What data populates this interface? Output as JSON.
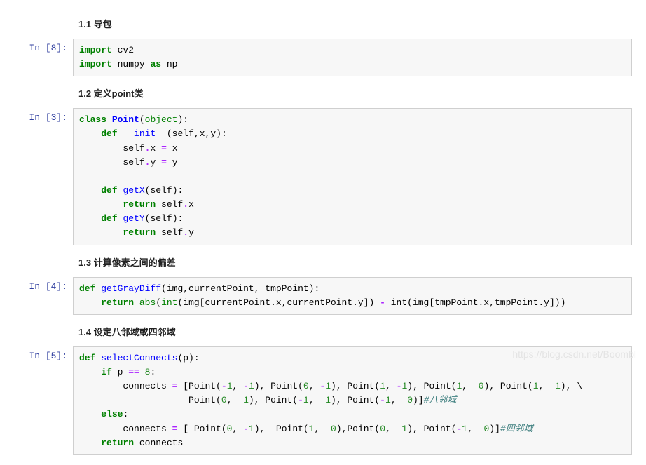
{
  "sections": {
    "s1": {
      "title": "1.1 导包"
    },
    "s2": {
      "title": "1.2 定义point类"
    },
    "s3": {
      "title": "1.3 计算像素之间的偏差"
    },
    "s4": {
      "title": "1.4 设定八邻域或四邻域"
    }
  },
  "cells": {
    "c1": {
      "label": "In  [8]:"
    },
    "c2": {
      "label": "In  [3]:"
    },
    "c3": {
      "label": "In  [4]:"
    },
    "c4": {
      "label": "In  [5]:"
    }
  },
  "code": {
    "c1": {
      "l1a": "import",
      "l1b": "cv2",
      "l2a": "import",
      "l2b": "numpy",
      "l2c": "as",
      "l2d": "np"
    },
    "c2": {
      "kw_class": "class",
      "cls_point": "Point",
      "builtin_object": "object",
      "kw_def": "def",
      "fn_init": "__init__",
      "self": "self",
      "x": "x",
      "y": "y",
      "fn_getX": "getX",
      "fn_getY": "getY",
      "kw_return": "return",
      "eq": "="
    },
    "c3": {
      "kw_def": "def",
      "fn_graydiff": "getGrayDiff",
      "args": "(img,currentPoint, tmpPoint):",
      "kw_return": "return",
      "fn_abs": "abs",
      "fn_int": "int",
      "expr1": "(img[currentPoint.x,currentPoint.y]) ",
      "minus": "-",
      "expr2": " int(img[tmpPoint.x,tmpPoint.y]))"
    },
    "c4": {
      "kw_def": "def",
      "fn_sel": "selectConnects",
      "args": "(p):",
      "kw_if": "if",
      "cond": "p ",
      "eqeq": "==",
      "eight": "8",
      "colon": ":",
      "connects_eq": "connects ",
      "eq": "=",
      "opensp": " [Point(",
      "m1": "-1",
      "comma": ", ",
      "one": "1",
      "zero": "0",
      "bksl": "\\",
      "comment1": "#八邻域",
      "kw_else": "else",
      "colon2": ":",
      "comment2": "#四邻域",
      "kw_return": "return",
      "ret": "connects"
    }
  },
  "watermark": "https://blog.csdn.net/Boombl"
}
